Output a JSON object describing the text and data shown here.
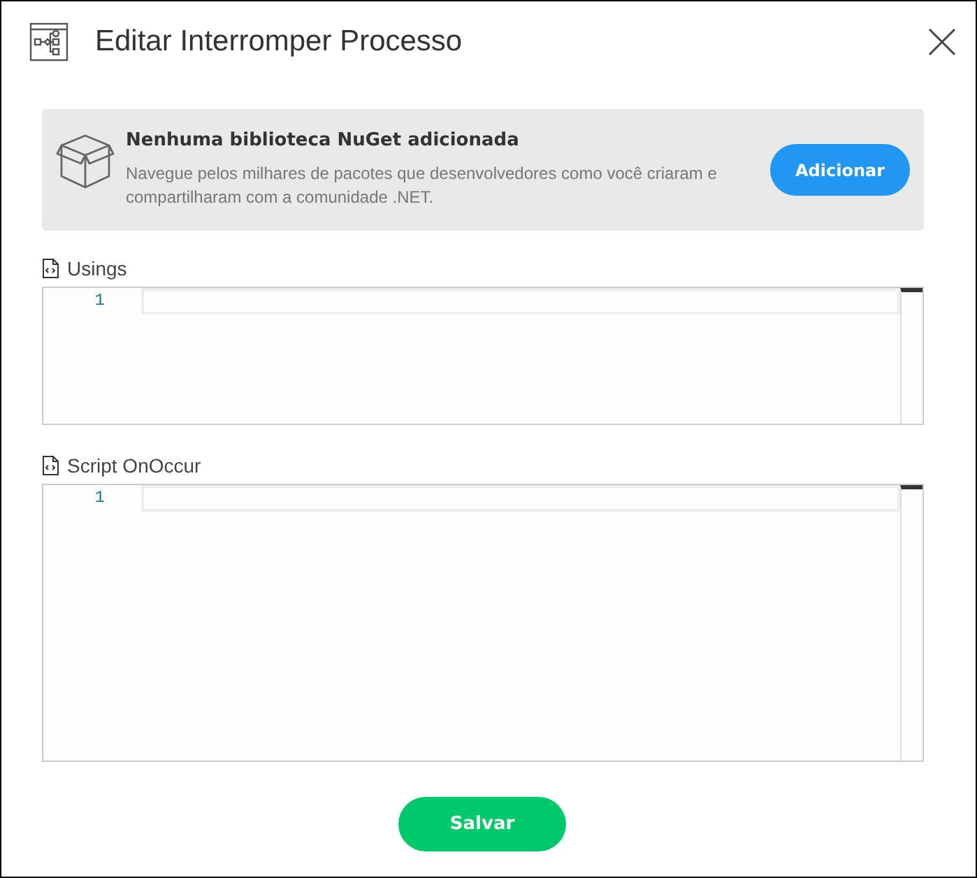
{
  "window": {
    "title": "Editar Interromper Processo"
  },
  "notice": {
    "title": "Nenhuma biblioteca NuGet adicionada",
    "description": "Navegue pelos milhares de pacotes que desenvolvedores como você criaram e compartilharam com a comunidade .NET.",
    "button": "Adicionar"
  },
  "editors": [
    {
      "label": "Usings",
      "line_numbers": [
        "1"
      ]
    },
    {
      "label": "Script OnOccur",
      "line_numbers": [
        "1"
      ]
    }
  ],
  "buttons": [
    "Salvar"
  ]
}
